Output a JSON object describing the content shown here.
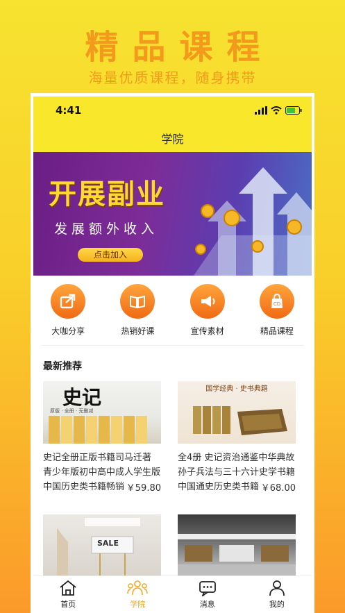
{
  "promo": {
    "title": "精品课程",
    "subtitle": "海量优质课程，随身携带"
  },
  "status_bar": {
    "time": "4:41"
  },
  "nav": {
    "title": "学院"
  },
  "banner": {
    "title": "开展副业",
    "subtitle": "发展额外收入",
    "button": "点击加入"
  },
  "quick_menu": [
    {
      "label": "大咖分享",
      "icon": "share-icon"
    },
    {
      "label": "热销好课",
      "icon": "book-icon"
    },
    {
      "label": "宣传素材",
      "icon": "megaphone-icon"
    },
    {
      "label": "精品课程",
      "icon": "course-bag-icon"
    }
  ],
  "section": {
    "title": "最新推荐"
  },
  "products": [
    {
      "title": "史记全册正版书籍司马迁著 青少年版初中高中成人学生版中国历史类书籍畅销书",
      "price": "￥59.80",
      "cover_text": "史记",
      "cover_sub": "原版 · 全册 · 无删减"
    },
    {
      "title": "全4册 史记资治通鉴中华典故孙子兵法与三十六计史学书籍中国通史历史类书籍",
      "price": "￥68.00",
      "cover_text": "国学经典 · 史书典籍"
    },
    {
      "title": "",
      "price": "",
      "cover_text": "SALE"
    },
    {
      "title": "",
      "price": "",
      "cover_text": ""
    }
  ],
  "tabs": [
    {
      "label": "首页",
      "icon": "home-icon",
      "active": false
    },
    {
      "label": "学院",
      "icon": "academy-icon",
      "active": true
    },
    {
      "label": "消息",
      "icon": "message-icon",
      "active": false
    },
    {
      "label": "我的",
      "icon": "profile-icon",
      "active": false
    }
  ],
  "colors": {
    "accent": "#f4a51e",
    "header": "#f8e72a",
    "icon_gradient_top": "#ffa53c",
    "icon_gradient_bottom": "#f06a14"
  }
}
